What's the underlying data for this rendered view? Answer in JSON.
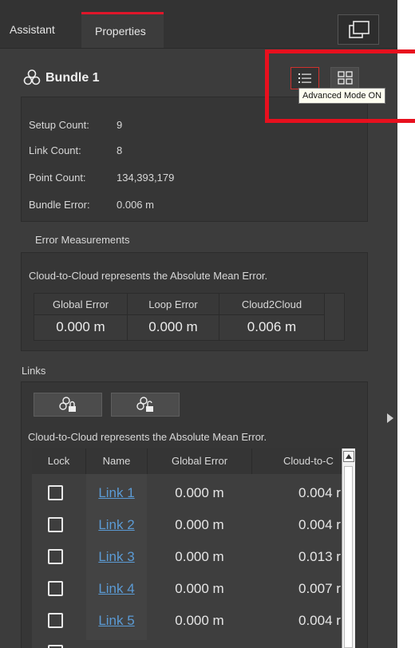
{
  "tabs": {
    "assistant": "Assistant",
    "properties": "Properties"
  },
  "bundle": {
    "title": "Bundle 1",
    "rows": [
      {
        "label": "Setup Count:",
        "value": "9"
      },
      {
        "label": "Link Count:",
        "value": "8"
      },
      {
        "label": "Point Count:",
        "value": "134,393,179"
      },
      {
        "label": "Bundle Error:",
        "value": "0.006 m"
      }
    ]
  },
  "tooltip": "Advanced Mode ON",
  "error_measurements": {
    "header": "Error Measurements",
    "note": "Cloud-to-Cloud represents the Absolute Mean Error.",
    "columns": [
      "Global Error",
      "Loop Error",
      "Cloud2Cloud"
    ],
    "values": [
      "0.000 m",
      "0.000 m",
      "0.006 m"
    ]
  },
  "links": {
    "header": "Links",
    "note": "Cloud-to-Cloud represents the Absolute Mean Error.",
    "columns": [
      "Lock",
      "Name",
      "Global Error",
      "Cloud-to-C"
    ],
    "rows": [
      {
        "name": "Link 1",
        "global": "0.000 m",
        "c2c": "0.004 r"
      },
      {
        "name": "Link 2",
        "global": "0.000 m",
        "c2c": "0.004 r"
      },
      {
        "name": "Link 3",
        "global": "0.000 m",
        "c2c": "0.013 r"
      },
      {
        "name": "Link 4",
        "global": "0.000 m",
        "c2c": "0.007 r"
      },
      {
        "name": "Link 5",
        "global": "0.000 m",
        "c2c": "0.004 r"
      }
    ]
  },
  "colors": {
    "accent": "#e0162a",
    "link": "#5b9bd5",
    "highlight": "#e8101e"
  },
  "icons": [
    "layout-panel-icon",
    "bundle-icon",
    "list-view-icon",
    "grid-view-icon",
    "lock-link-icon",
    "unlock-link-icon",
    "expand-arrow-icon",
    "scroll-up-icon"
  ]
}
